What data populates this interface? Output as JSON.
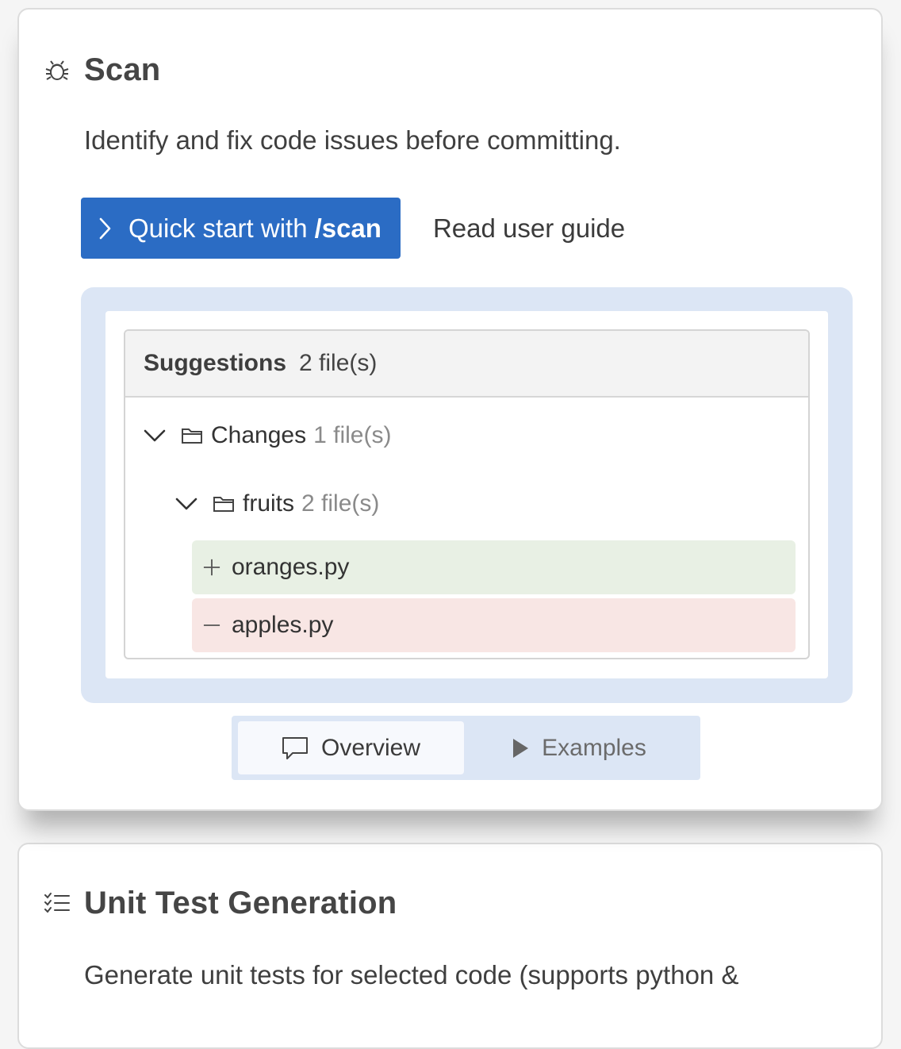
{
  "scan": {
    "title": "Scan",
    "icon": "bug-icon",
    "description": "Identify and fix code issues before committing.",
    "quick_start_prefix": "Quick start with",
    "quick_start_command": "/scan",
    "guide_link": "Read user guide",
    "suggestions": {
      "title": "Suggestions",
      "count": "2 file(s)",
      "folders": [
        {
          "name": "Changes",
          "count": "1 file(s)"
        },
        {
          "name": "fruits",
          "count": "2 file(s)"
        }
      ],
      "files": [
        {
          "name": "oranges.py",
          "status": "added"
        },
        {
          "name": "apples.py",
          "status": "removed"
        }
      ]
    },
    "tabs": [
      {
        "label": "Overview",
        "icon": "comment-icon",
        "active": true
      },
      {
        "label": "Examples",
        "icon": "play-icon",
        "active": false
      }
    ]
  },
  "unit_test": {
    "title": "Unit Test Generation",
    "icon": "checklist-icon",
    "description": "Generate unit tests for selected code (supports python &"
  },
  "colors": {
    "primary": "#2b6cc4",
    "frame": "#dce6f5",
    "added_bg": "#e8f0e4",
    "removed_bg": "#f8e6e4"
  }
}
